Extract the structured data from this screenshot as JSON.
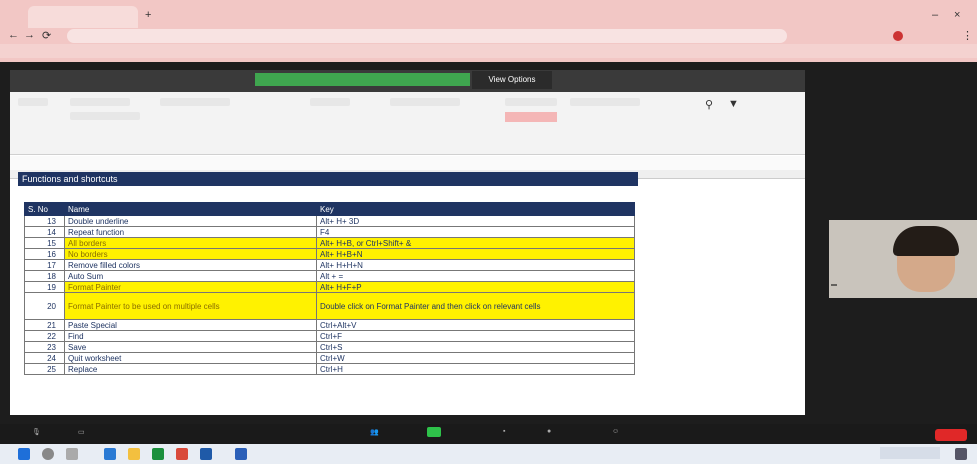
{
  "view_options_label": "View Options",
  "sheet": {
    "title": "Functions and shortcuts",
    "headers": [
      "S. No",
      "Name",
      "Key"
    ],
    "rows": [
      {
        "sn": "13",
        "name": "Double underline",
        "key": "Alt+ H+ 3D",
        "hl": false
      },
      {
        "sn": "14",
        "name": "Repeat function",
        "key": "F4",
        "hl": false
      },
      {
        "sn": "15",
        "name": "All borders",
        "key": "Alt+ H+B, or Ctrl+Shift+ &",
        "hl": true
      },
      {
        "sn": "16",
        "name": "No borders",
        "key": "Alt+ H+B+N",
        "hl": true
      },
      {
        "sn": "17",
        "name": "Remove filled colors",
        "key": "Alt+ H+H+N",
        "hl": false
      },
      {
        "sn": "18",
        "name": "Auto Sum",
        "key": "Alt + =",
        "hl": false
      },
      {
        "sn": "19",
        "name": "Format Painter",
        "key": "Alt+ H+F+P",
        "hl": true
      },
      {
        "sn": "20",
        "name": "Format Painter to be used on multiple cells",
        "key": "Double click on Format Painter and then click on relevant cells",
        "hl": true,
        "tall": true
      },
      {
        "sn": "21",
        "name": "Paste Special",
        "key": "Ctrl+Alt+V",
        "hl": false
      },
      {
        "sn": "22",
        "name": "Find",
        "key": "Ctrl+F",
        "hl": false
      },
      {
        "sn": "23",
        "name": "Save",
        "key": "Ctrl+S",
        "hl": false
      },
      {
        "sn": "24",
        "name": "Quit worksheet",
        "key": "Ctrl+W",
        "hl": false
      },
      {
        "sn": "25",
        "name": "Replace",
        "key": "Ctrl+H",
        "hl": false
      }
    ]
  }
}
